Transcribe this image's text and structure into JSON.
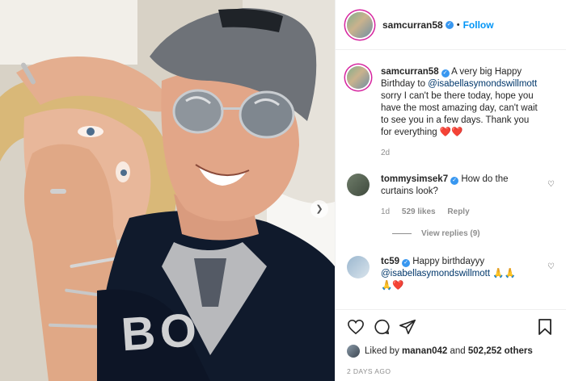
{
  "post": {
    "author": "samcurran58",
    "follow_label": "Follow",
    "dot": "•",
    "verified_symbol": "✓"
  },
  "photo": {
    "alt": "Selfie of a man in a grey cap and mirrored sunglasses with a woman resting her head on his shoulder",
    "shirt_text": "BO"
  },
  "caption": {
    "username": "samcurran58",
    "text_before": "A very big Happy Birthday to ",
    "mention": "@isabellasymondswillmott",
    "text_after": " sorry I can't be there today, hope you have the most amazing day, can't wait to see you in a few days. Thank you for everything ",
    "emoji": "❤️❤️",
    "time": "2d"
  },
  "comments": [
    {
      "username": "tommysimsek7",
      "text": "How do the curtains look?",
      "time": "1d",
      "likes": "529 likes",
      "reply": "Reply",
      "view_replies": "View replies (9)"
    },
    {
      "username": "tc59",
      "text": "Happy birthdayyy",
      "mention": "@isabellasymondswillmott",
      "emoji_inline": "🙏🙏",
      "emoji_line2": "🙏❤️"
    }
  ],
  "likes": {
    "prefix": "Liked by ",
    "user": "manan042",
    "middle": " and ",
    "count": "502,252 others"
  },
  "time_ago": "2 DAYS AGO",
  "colors": {
    "accent": "#0095f6",
    "verified": "#3897f0",
    "muted": "#8e8e8e",
    "mention": "#00376b"
  }
}
